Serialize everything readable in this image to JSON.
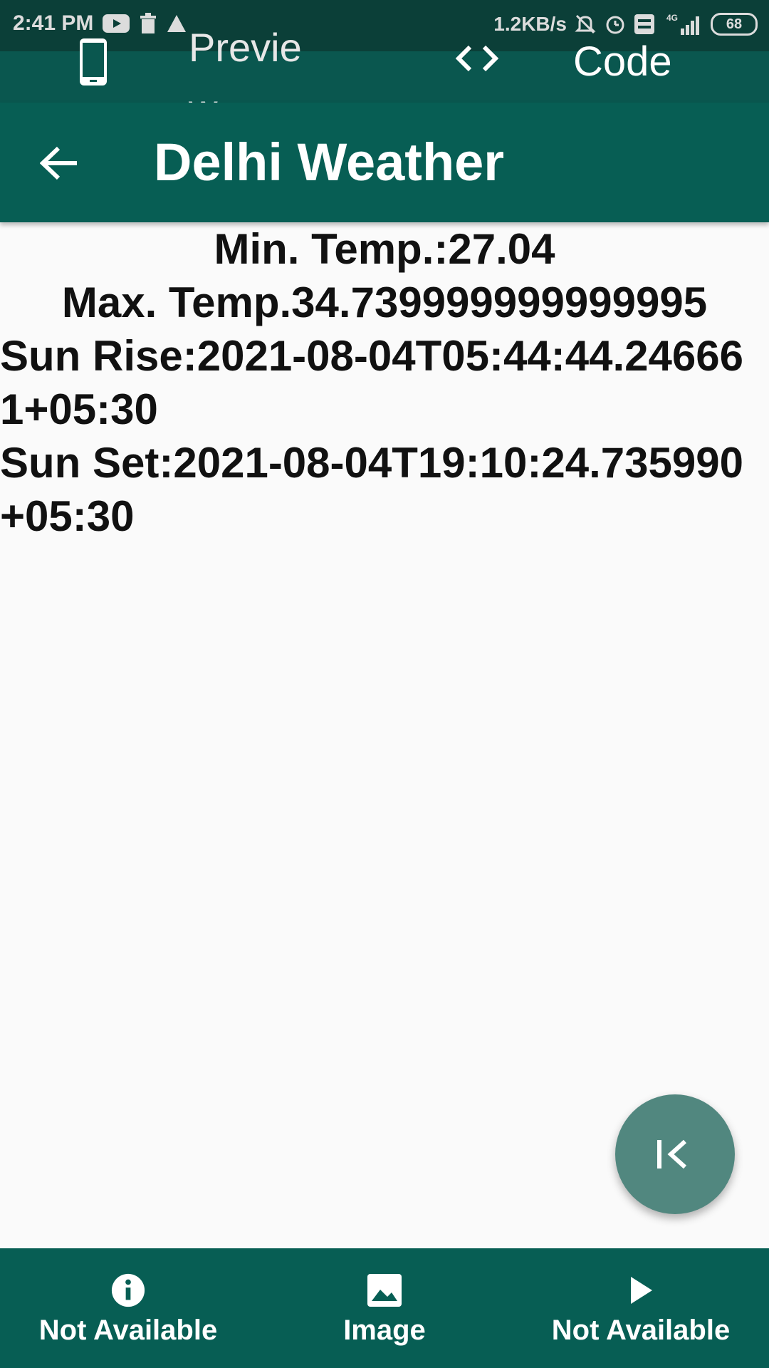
{
  "status_bar": {
    "time": "2:41 PM",
    "net_speed": "1.2KB/s",
    "network": "4G",
    "battery": "68",
    "icons": [
      "youtube-icon",
      "trash-icon",
      "warning-icon",
      "mute-icon",
      "alarm-icon",
      "volte-icon",
      "signal-icon"
    ]
  },
  "top_bar": {
    "preview_label": "Preview",
    "code_label": "Code",
    "icons": [
      "phone-icon",
      "code-chevrons-icon"
    ]
  },
  "app_bar": {
    "title": "Delhi Weather",
    "back_icon": "arrow-left-icon"
  },
  "weather": {
    "min_temp": "Min. Temp.:27.04",
    "max_temp": "Max. Temp.34.739999999999995",
    "sun_rise": "Sun Rise:2021-08-04T05:44:44.246661+05:30",
    "sun_set": "Sun Set:2021-08-04T19:10:24.735990+05:30"
  },
  "fab": {
    "icon": "collapse-left-icon"
  },
  "bottom_nav": {
    "items": [
      {
        "label": "Not Available",
        "icon": "info-icon"
      },
      {
        "label": "Image",
        "icon": "image-icon"
      },
      {
        "label": "Not Available",
        "icon": "play-icon"
      }
    ]
  },
  "colors": {
    "status_bar": "#0b3f38",
    "top_bar": "#0a574f",
    "app_bar": "#075e54",
    "fab": "#51877f",
    "background": "#fafafa"
  }
}
